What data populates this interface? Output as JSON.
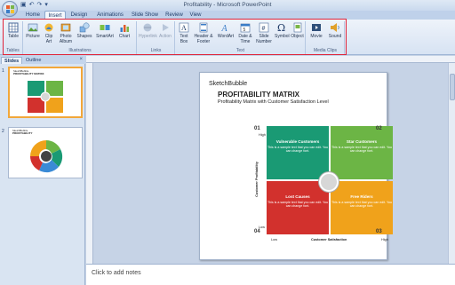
{
  "window": {
    "title": "Profitability - Microsoft PowerPoint"
  },
  "tabs": [
    "Home",
    "Insert",
    "Design",
    "Animations",
    "Slide Show",
    "Review",
    "View"
  ],
  "active_tab": "Insert",
  "ribbon": {
    "groups": [
      {
        "label": "Tables",
        "buttons": [
          "Table"
        ]
      },
      {
        "label": "Illustrations",
        "buttons": [
          "Picture",
          "Clip Art",
          "Photo Album",
          "Shapes",
          "SmartArt",
          "Chart"
        ]
      },
      {
        "label": "Links",
        "buttons": [
          "Hyperlink",
          "Action"
        ]
      },
      {
        "label": "Text",
        "buttons": [
          "Text Box",
          "Header & Footer",
          "WordArt",
          "Date & Time",
          "Slide Number",
          "Symbol",
          "Object"
        ]
      },
      {
        "label": "Media Clips",
        "buttons": [
          "Movie",
          "Sound"
        ]
      }
    ]
  },
  "left_panel": {
    "tabs": [
      "Slides",
      "Outline"
    ],
    "close": "×",
    "slide_numbers": [
      "1",
      "2"
    ]
  },
  "slide": {
    "logo": "SketchBubble",
    "title": "PROFITABILITY MATRIX",
    "subtitle": "Profitability Matrix with Customer Satisfaction Level",
    "quadrants": [
      {
        "num": "01",
        "title": "Vulnerable Customers",
        "text": "This is a sample text that you can edit. You can change font.",
        "color": "#1a9a74"
      },
      {
        "num": "02",
        "title": "Star Customers",
        "text": "This is a sample text that you can edit. You can change font.",
        "color": "#6cb545"
      },
      {
        "num": "03",
        "title": "Free Riders",
        "text": "This is a sample text that you can edit. You can change font.",
        "color": "#f0a21b"
      },
      {
        "num": "04",
        "title": "Lost Causes",
        "text": "This is a sample text that you can edit. You can change font.",
        "color": "#d2312d"
      }
    ],
    "y_axis_label": "Customer Profitability",
    "x_axis_label": "Customer Satisfaction",
    "high": "High",
    "low": "Low"
  },
  "thumb1": {
    "logo": "SketchBubble",
    "title": "PROFITABILITY MATRIX"
  },
  "thumb2": {
    "logo": "SketchBubble",
    "title": "PROFITABILITY"
  },
  "notes": {
    "placeholder": "Click to add notes"
  }
}
